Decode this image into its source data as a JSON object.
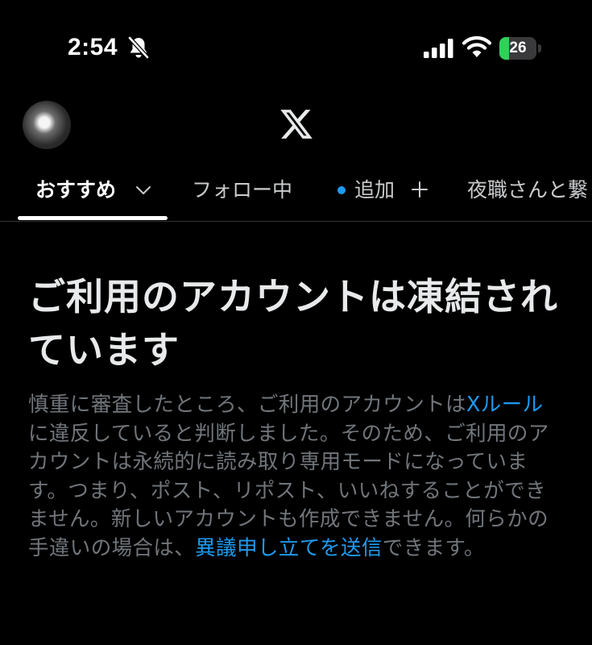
{
  "status_bar": {
    "time": "2:54",
    "battery_level": "26",
    "battery_fraction": 0.26,
    "icons": [
      "bell-slash-icon",
      "signal-icon",
      "wifi-icon",
      "battery-icon"
    ]
  },
  "header": {
    "logo": "X"
  },
  "tabs": [
    {
      "label": "おすすめ",
      "active": true,
      "icon": "chevron-down-icon"
    },
    {
      "label": "フォロー中",
      "active": false
    },
    {
      "label": "追加",
      "active": false,
      "icon": "plus-icon"
    },
    {
      "label": "夜職さんと繋",
      "active": false
    }
  ],
  "main": {
    "title": "ご利用のアカウントは凍結されています",
    "body_part1": "慎重に審査したところ、ご利用のアカウントは",
    "rules_link": "Xルール",
    "body_part2": "に違反していると判断しました。そのため、ご利用のアカウントは永続的に読み取り専用モードになっています。つまり、ポスト、リポスト、いいねすることができません。新しいアカウントも作成できません。何らかの手違いの場合は、",
    "appeal_link": "異議申し立てを送信",
    "body_part3": "できます。"
  },
  "colors": {
    "background": "#000000",
    "text_primary": "#e7e9ea",
    "text_secondary": "#71767b",
    "link": "#1d9bf0",
    "battery_green": "#30d158"
  }
}
